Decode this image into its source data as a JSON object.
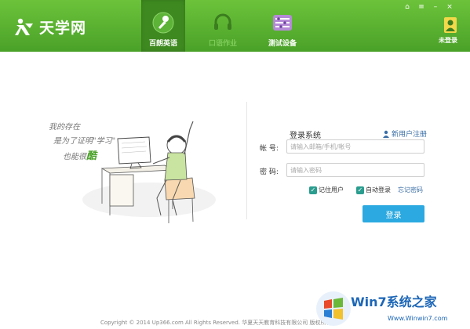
{
  "app": {
    "brand": "天学网",
    "accent": "#4aa128",
    "accent_dark": "#3e8a20"
  },
  "nav": {
    "tabs": [
      {
        "label": "百朗英语",
        "icon": "microphone-icon",
        "active": true
      },
      {
        "label": "口语作业",
        "icon": "headset-icon",
        "active": false
      },
      {
        "label": "测试设备",
        "icon": "equipment-icon",
        "active": false
      }
    ]
  },
  "window_controls": {
    "home": "⌂",
    "menu": "≡",
    "minimize": "–",
    "close": "×"
  },
  "user": {
    "label": "未登录",
    "icon": "user-icon"
  },
  "illustration": {
    "tagline_line1": "我的存在",
    "tagline_line2": "是为了证明\"学习\"",
    "tagline_line3": "也能很",
    "tagline_emph": "酷"
  },
  "login": {
    "title": "登录系统",
    "register_link": "新用户注册",
    "account_label": "帐  号:",
    "account_placeholder": "请输入邮箱/手机/帐号",
    "password_label": "密  码:",
    "password_placeholder": "请输入密码",
    "remember_label": "记住用户",
    "auto_login_label": "自动登录",
    "forgot_link": "忘记密码",
    "submit_label": "登录"
  },
  "footer": {
    "copyright": "Copyright © 2014 Up366.com All Rights Reserved. 华夏天天教育科技有限公司 版权所有"
  },
  "watermark": {
    "text": "Win7系统之家",
    "url": "Www.Winwin7.com"
  }
}
